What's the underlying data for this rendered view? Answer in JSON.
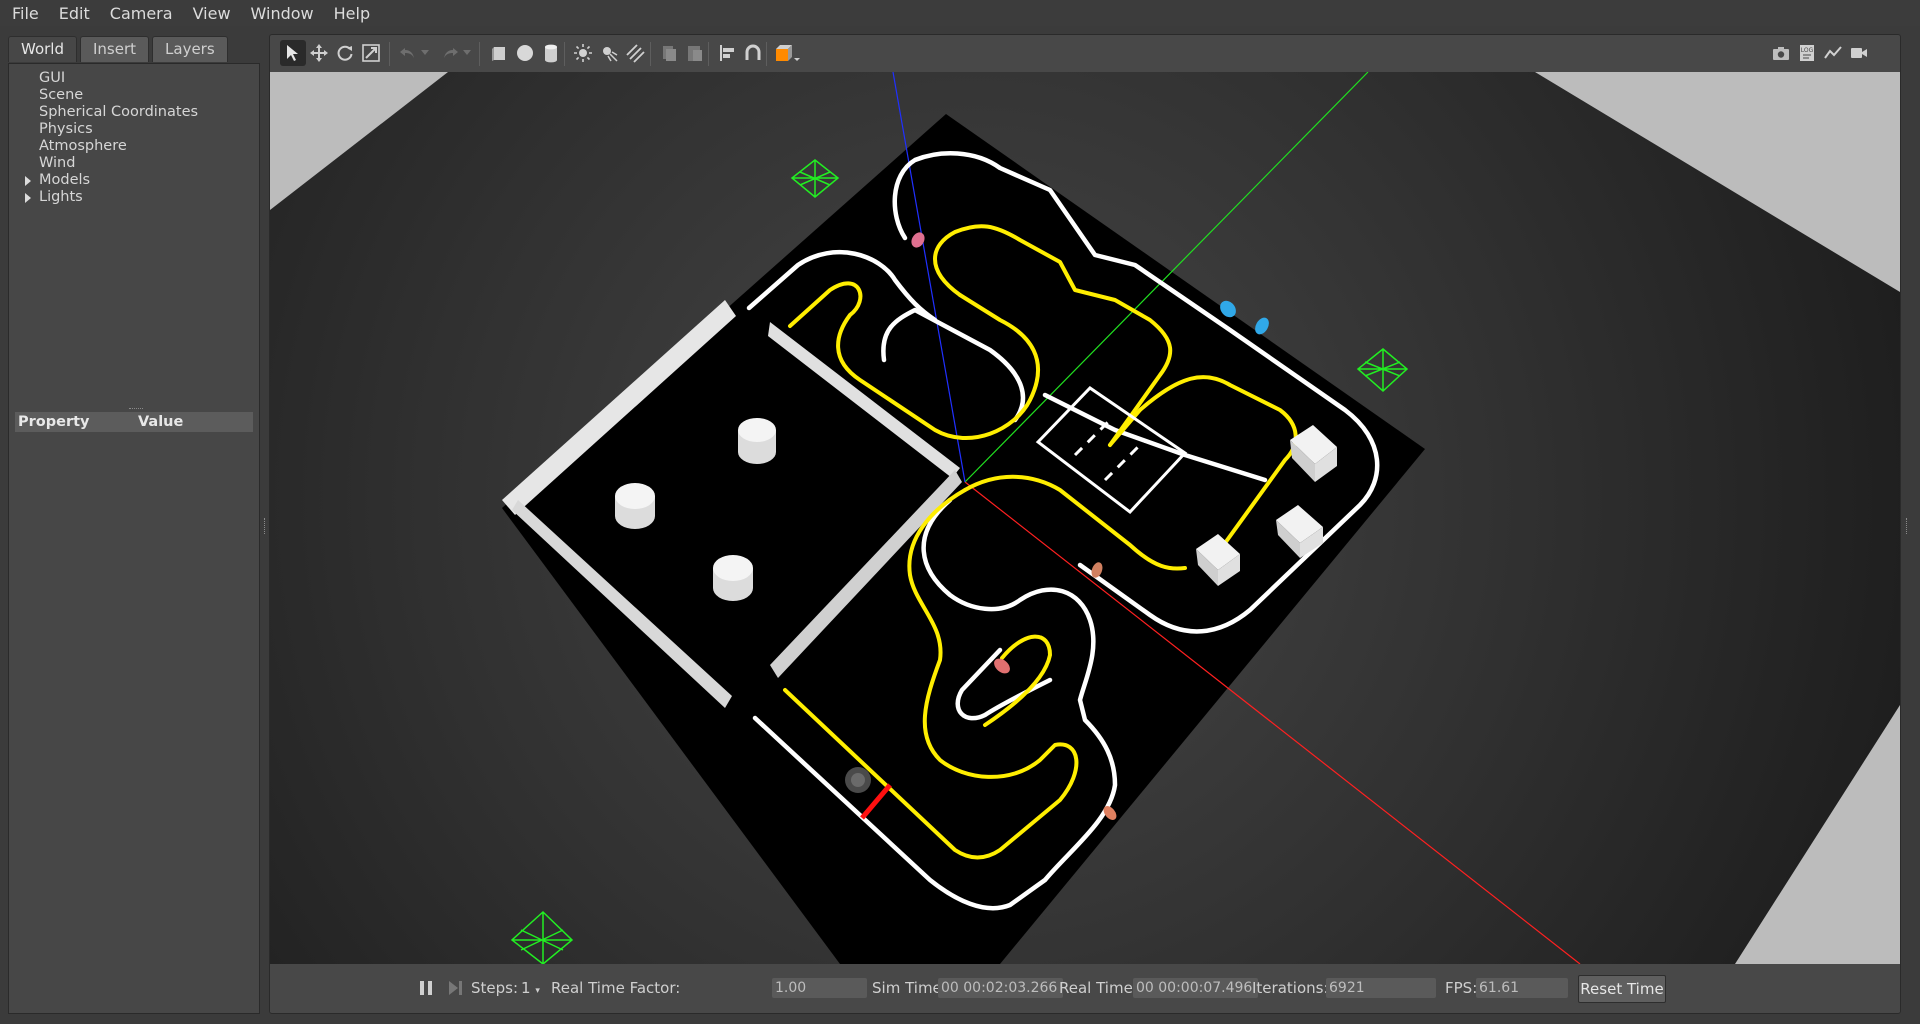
{
  "menubar": {
    "items": [
      "File",
      "Edit",
      "Camera",
      "View",
      "Window",
      "Help"
    ]
  },
  "left_panel": {
    "tabs": [
      "World",
      "Insert",
      "Layers"
    ],
    "active_tab": "World",
    "tree": [
      {
        "label": "GUI",
        "expandable": false
      },
      {
        "label": "Scene",
        "expandable": false
      },
      {
        "label": "Spherical Coordinates",
        "expandable": false
      },
      {
        "label": "Physics",
        "expandable": false
      },
      {
        "label": "Atmosphere",
        "expandable": false
      },
      {
        "label": "Wind",
        "expandable": false
      },
      {
        "label": "Models",
        "expandable": true
      },
      {
        "label": "Lights",
        "expandable": true
      }
    ],
    "property_header": {
      "property": "Property",
      "value": "Value"
    }
  },
  "toolbar": {
    "left_tools": [
      "select-mode-icon",
      "translate-mode-icon",
      "rotate-mode-icon",
      "scale-mode-icon",
      "undo-icon",
      "undo-history-icon",
      "redo-icon",
      "redo-history-icon",
      "box-shape-icon",
      "sphere-shape-icon",
      "cylinder-shape-icon",
      "point-light-icon",
      "spot-light-icon",
      "directional-light-icon",
      "copy-icon",
      "paste-icon",
      "align-icon",
      "snap-icon",
      "view-angle-icon"
    ],
    "right_tools": [
      "screenshot-icon",
      "log-icon",
      "plot-icon",
      "record-video-icon"
    ]
  },
  "bottombar": {
    "steps_label": "Steps:",
    "steps_value": "1",
    "rtf_label": "Real Time Factor:",
    "rtf_value": "1.00",
    "sim_time_label": "Sim Time:",
    "sim_time_value": "00 00:02:03.266",
    "real_time_label": "Real Time:",
    "real_time_value": "00 00:00:07.496",
    "iterations_label": "Iterations:",
    "iterations_value": "6921",
    "fps_label": "FPS:",
    "fps_value": "61.61",
    "reset_label": "Reset Time"
  },
  "colors": {
    "lane_yellow": "#ffee00",
    "lane_white": "#ffffff",
    "x_axis": "#ff2020",
    "y_axis": "#20e020",
    "z_axis": "#2030ff",
    "camera_marker": "#22ee22",
    "selected_tool_orange": "#ff8a00"
  }
}
